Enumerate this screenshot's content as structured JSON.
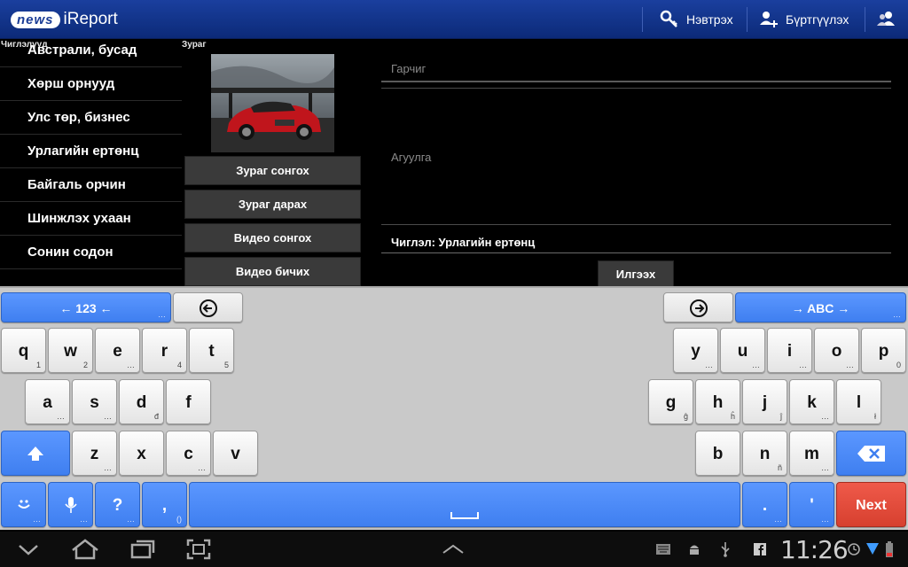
{
  "app": {
    "logo_badge": "news",
    "logo_brand": "iReport"
  },
  "header": {
    "login": "Нэвтрэх",
    "register": "Бүртгүүлэх"
  },
  "labels": {
    "categories": "Чиглэлүүд",
    "image": "Зураг"
  },
  "categories": [
    "Австрали, бусад",
    "Хөрш орнууд",
    "Улс төр, бизнес",
    "Урлагийн ертөнц",
    "Байгаль орчин",
    "Шинжлэх ухаан",
    "Сонин содон"
  ],
  "media_buttons": [
    "Зураг сонгох",
    "Зураг дарах",
    "Видео сонгох",
    "Видео бичих"
  ],
  "form": {
    "title_placeholder": "Гарчиг",
    "content_placeholder": "Агуулга",
    "category_line": "Чиглэл: Урлагийн ертөнц",
    "send": "Илгээх"
  },
  "keyboard": {
    "mode_left": "← 123 ←",
    "mode_right": "→ ABC →",
    "row1": [
      [
        "q",
        "1"
      ],
      [
        "w",
        "2"
      ],
      [
        "e",
        "…"
      ],
      [
        "r",
        "4"
      ],
      [
        "t",
        "5"
      ]
    ],
    "row1r": [
      [
        "y",
        "…"
      ],
      [
        "u",
        "…"
      ],
      [
        "i",
        "…"
      ],
      [
        "o",
        "…"
      ],
      [
        "p",
        "0"
      ]
    ],
    "row2": [
      [
        "a",
        "…"
      ],
      [
        "s",
        "…"
      ],
      [
        "d",
        "đ"
      ],
      [
        "f",
        ""
      ]
    ],
    "row2r": [
      [
        "g",
        "ĝ"
      ],
      [
        "h",
        "ĥ"
      ],
      [
        "j",
        "ĵ"
      ],
      [
        "k",
        "…"
      ],
      [
        "l",
        "ł"
      ]
    ],
    "row3": [
      [
        "z",
        "…"
      ],
      [
        "x",
        ""
      ],
      [
        "c",
        "…"
      ],
      [
        "v",
        ""
      ]
    ],
    "row3r": [
      [
        "b",
        ""
      ],
      [
        "n",
        "ñ"
      ],
      [
        "m",
        "…"
      ]
    ],
    "q_key": "?",
    "comma": ",",
    "comma_sub": "()",
    "dot": ".",
    "quote": "'",
    "next": "Next"
  },
  "status": {
    "time": "11:26"
  },
  "colors": {
    "accent_blue": "#3f7ff0",
    "next_red": "#d7402f",
    "bar_blue": "#0c2a78"
  }
}
